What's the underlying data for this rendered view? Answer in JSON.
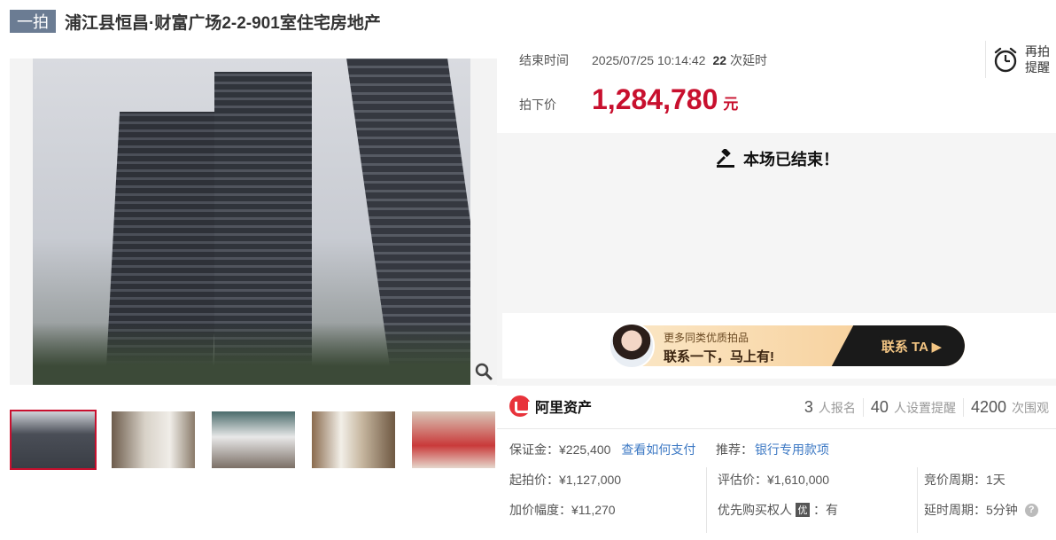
{
  "header": {
    "badge": "一拍",
    "title": "浦江县恒昌·财富广场2-2-901室住宅房地产"
  },
  "auction": {
    "end_label": "结束时间",
    "end_time": "2025/07/25 10:14:42",
    "delay_count": "22",
    "delay_unit": "次延时",
    "remind_label_1": "再拍",
    "remind_label_2": "提醒",
    "price_label": "拍下价",
    "price": "1,284,780",
    "price_unit": "元",
    "ended_text": "本场已结束！"
  },
  "banner": {
    "line1": "更多同类优质拍品",
    "line2": "联系一下，马上有!",
    "cta": "联系 TA ▶"
  },
  "brand": {
    "name": "阿里资产"
  },
  "stats": [
    {
      "num": "3",
      "unit": "人报名"
    },
    {
      "num": "40",
      "unit": "人设置提醒"
    },
    {
      "num": "4200",
      "unit": "次围观"
    }
  ],
  "details": {
    "deposit": "保证金：¥225,400",
    "pay_link": "查看如何支付",
    "recommend_label": "推荐：",
    "recommend_link": "银行专用款项",
    "start_price": "起拍价：¥1,127,000",
    "eval_price": "评估价：¥1,610,000",
    "bid_period": "竞价周期：1天",
    "increment": "加价幅度：¥11,270",
    "priority_label": "优先购买权人",
    "priority_icon": "优",
    "priority_value": "：有",
    "delay_period": "延时周期：5分钟"
  },
  "colors": {
    "accent": "#c8102e",
    "link": "#3d79c4",
    "badge": "#6b7c93"
  }
}
